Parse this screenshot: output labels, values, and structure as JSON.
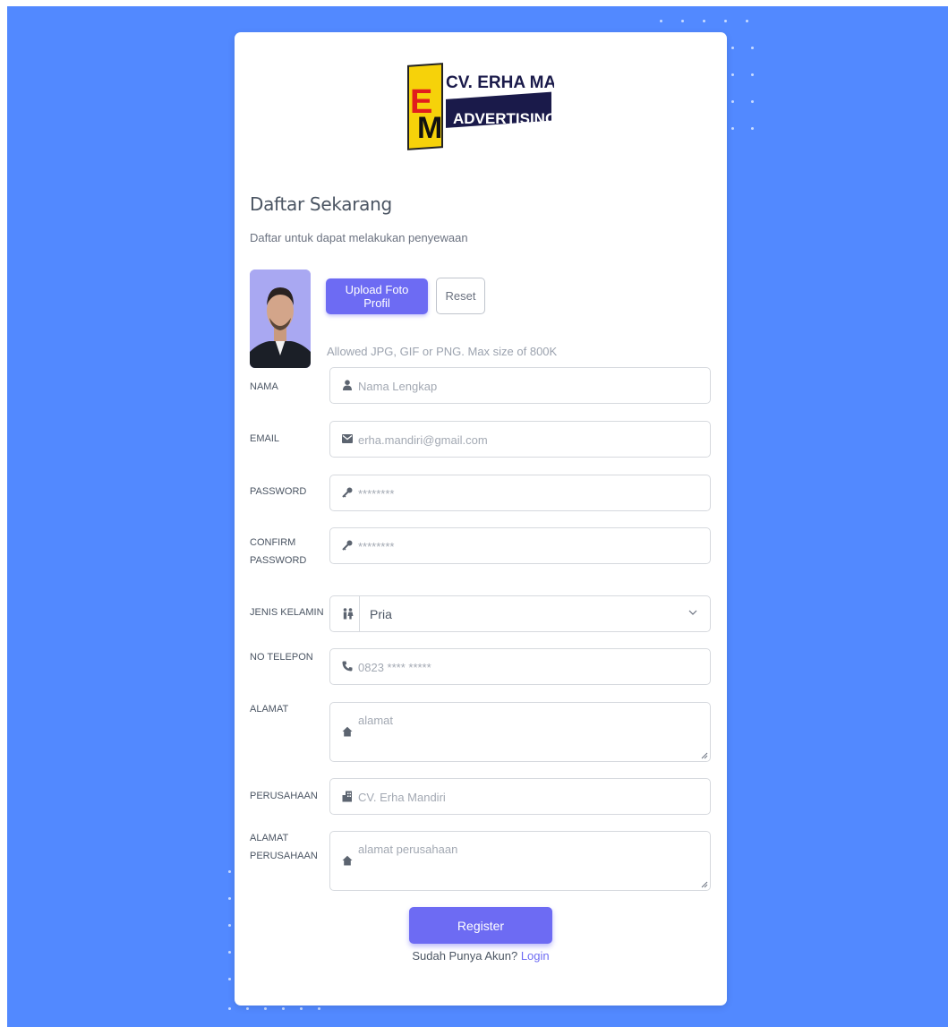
{
  "colors": {
    "background": "#5289ff",
    "primary": "#6d6bf3",
    "card": "#ffffff"
  },
  "logo": {
    "line1": "CV. ERHA MANDIRI",
    "line2": "ADVERTISING",
    "monogram": "EM"
  },
  "header": {
    "title": "Daftar Sekarang",
    "subtitle": "Daftar untuk dapat melakukan penyewaan"
  },
  "profile": {
    "upload_label": "Upload Foto Profil",
    "reset_label": "Reset",
    "allowed_text": "Allowed JPG, GIF or PNG. Max size of 800K"
  },
  "form": {
    "nama": {
      "label": "NAMA",
      "placeholder": "Nama Lengkap",
      "icon": "user-icon"
    },
    "email": {
      "label": "EMAIL",
      "placeholder": "erha.mandiri@gmail.com",
      "icon": "envelope-icon"
    },
    "password": {
      "label": "PASSWORD",
      "placeholder": "********",
      "icon": "key-icon"
    },
    "confirm_password": {
      "label": "CONFIRM PASSWORD",
      "placeholder": "********",
      "icon": "key-icon"
    },
    "jenis_kelamin": {
      "label": "JENIS KELAMIN",
      "value": "Pria",
      "icon": "people-icon"
    },
    "no_telepon": {
      "label": "NO TELEPON",
      "placeholder": "0823 **** *****",
      "icon": "phone-icon"
    },
    "alamat": {
      "label": "ALAMAT",
      "placeholder": "alamat",
      "icon": "home-icon"
    },
    "perusahaan": {
      "label": "PERUSAHAAN",
      "placeholder": "CV. Erha Mandiri",
      "icon": "building-icon"
    },
    "alamat_perusahaan": {
      "label": "ALAMAT PERUSAHAAN",
      "placeholder": "alamat perusahaan",
      "icon": "home-icon"
    }
  },
  "footer": {
    "register_label": "Register",
    "login_prompt": "Sudah Punya Akun?",
    "login_link": "Login"
  }
}
